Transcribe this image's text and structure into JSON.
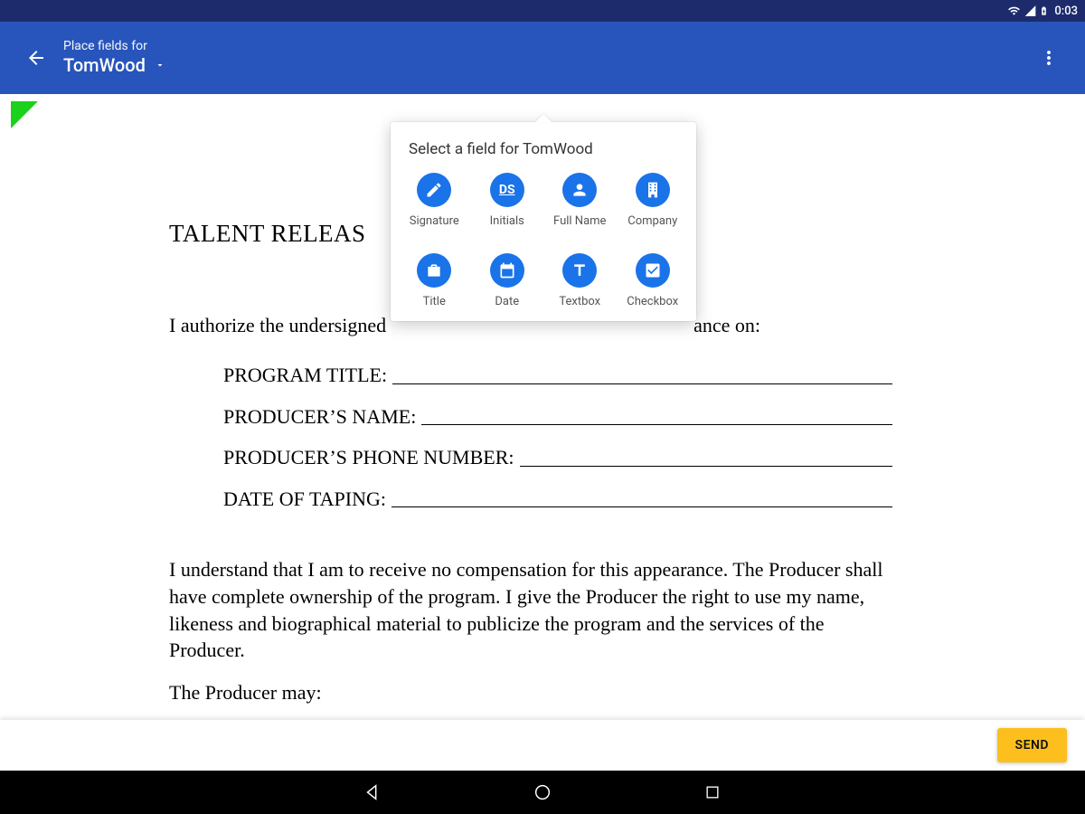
{
  "status": {
    "time": "0:03"
  },
  "appbar": {
    "subtitle": "Place fields for",
    "title": "TomWood"
  },
  "popover": {
    "title": "Select a field for TomWood",
    "fields": [
      {
        "label": "Signature"
      },
      {
        "label": "Initials"
      },
      {
        "label": "Full Name"
      },
      {
        "label": "Company"
      },
      {
        "label": "Title"
      },
      {
        "label": "Date"
      },
      {
        "label": "Textbox"
      },
      {
        "label": "Checkbox"
      }
    ]
  },
  "document": {
    "heading_partial": "TALENT RELEAS",
    "intro_left": "I authorize the undersigned",
    "intro_right": "ance on:",
    "lines": [
      "PROGRAM TITLE:",
      "PRODUCER’S NAME:",
      "PRODUCER’S PHONE NUMBER:",
      "DATE OF TAPING:"
    ],
    "para1": "I understand that I am to receive no compensation for this appearance. The Producer shall have complete ownership of the program. I give the Producer the right to use my name, likeness and biographical material to publicize the program and the services of the Producer.",
    "para2": "The Producer may:"
  },
  "footer": {
    "send": "SEND"
  }
}
